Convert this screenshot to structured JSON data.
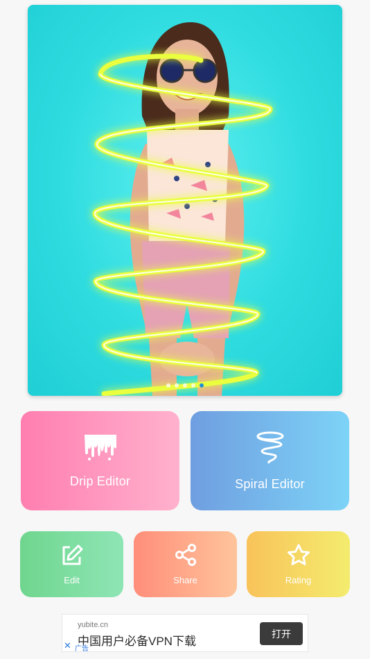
{
  "carousel": {
    "slide_count": 5,
    "active_index": 4
  },
  "features": {
    "drip": {
      "label": "Drip Editor",
      "icon": "drip-icon"
    },
    "spiral": {
      "label": "Spiral Editor",
      "icon": "spiral-icon"
    }
  },
  "actions": {
    "edit": {
      "label": "Edit",
      "icon": "edit-icon"
    },
    "share": {
      "label": "Share",
      "icon": "share-icon"
    },
    "rating": {
      "label": "Rating",
      "icon": "star-icon"
    }
  },
  "ad": {
    "domain": "yubite.cn",
    "headline": "中国用户必备VPN下载",
    "button": "打开",
    "tag": "广告"
  },
  "colors": {
    "drip_gradient": [
      "#ff7eb0",
      "#ffb1cd"
    ],
    "spiral_gradient": [
      "#6f9ee0",
      "#7dd3f7"
    ],
    "edit_gradient": [
      "#6fd68e",
      "#8ee5b5"
    ],
    "share_gradient": [
      "#ff8e7a",
      "#ffc49b"
    ],
    "rating_gradient": [
      "#f8c35a",
      "#f4ec6e"
    ],
    "banner_bg": "#2fdce0",
    "neon": "#e8ff3a"
  }
}
